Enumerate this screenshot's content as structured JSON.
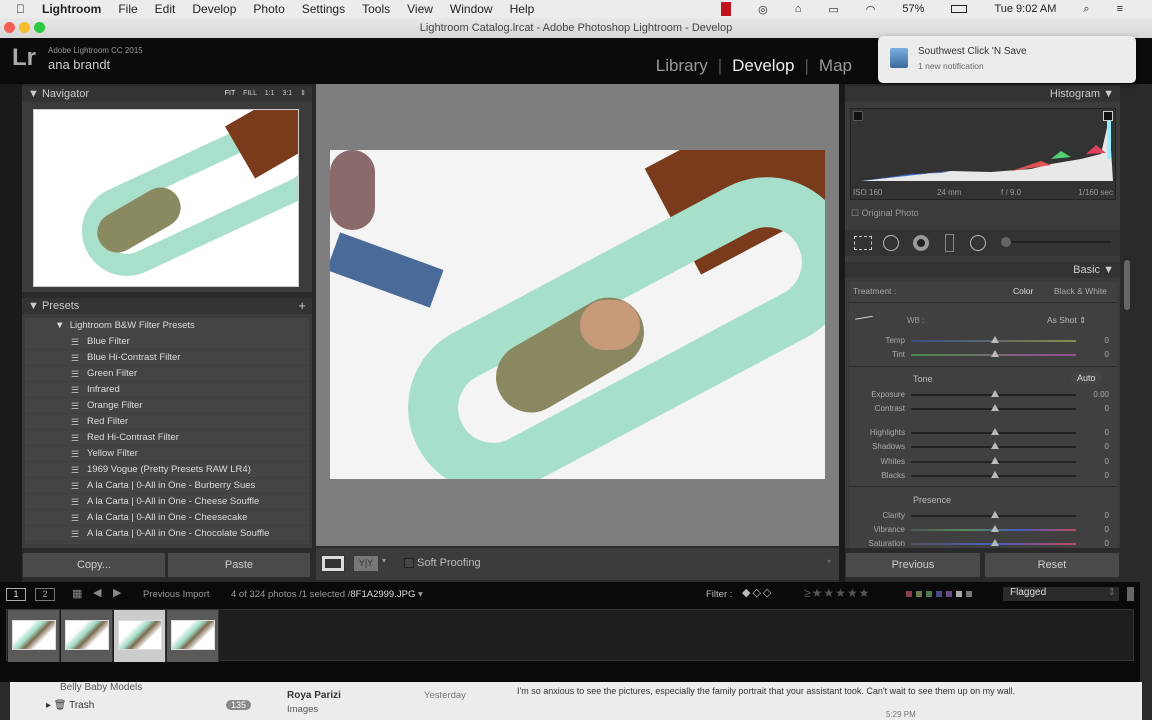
{
  "menubar": {
    "apple": "",
    "items": [
      "Lightroom",
      "File",
      "Edit",
      "Develop",
      "Photo",
      "Settings",
      "Tools",
      "View",
      "Window",
      "Help"
    ],
    "battery": "57%",
    "clock": "Tue 9:02 AM"
  },
  "window": {
    "title": "Lightroom Catalog.lrcat - Adobe Photoshop Lightroom - Develop"
  },
  "header": {
    "logo": "Lr",
    "product": "Adobe Lightroom CC 2015",
    "user": "ana brandt",
    "modules": [
      "Library",
      "Develop",
      "Map"
    ],
    "active_module": "Develop"
  },
  "notification": {
    "title": "Southwest Click 'N Save",
    "body": "1 new notification"
  },
  "navigator": {
    "title": "Navigator",
    "zoom": [
      "FIT",
      "FILL",
      "1:1",
      "3:1"
    ]
  },
  "presets": {
    "title": "Presets",
    "add": "+",
    "folder": "Lightroom B&W Filter Presets",
    "items": [
      "Blue Filter",
      "Blue Hi-Contrast Filter",
      "Green Filter",
      "Infrared",
      "Orange Filter",
      "Red Filter",
      "Red Hi-Contrast Filter",
      "Yellow Filter",
      "1969 Vogue (Pretty Presets RAW LR4)",
      "A la Carta | 0-All in One - Burberry Sues",
      "A la Carta | 0-All in One - Cheese Souffle",
      "A la Carta | 0-All in One - Cheesecake",
      "A la Carta | 0-All in One - Chocolate Souffle"
    ]
  },
  "left_buttons": {
    "copy": "Copy...",
    "paste": "Paste"
  },
  "toolbar": {
    "soft_proofing": "Soft Proofing",
    "view_mode": "Y|Y"
  },
  "histogram": {
    "title": "Histogram",
    "iso": "ISO 160",
    "focal": "24 mm",
    "aperture": "f / 9.0",
    "shutter": "1/160 sec",
    "original_photo": "Original Photo"
  },
  "basic": {
    "title": "Basic",
    "treatment_label": "Treatment :",
    "treatment_color": "Color",
    "treatment_bw": "Black & White",
    "wb_label": "WB :",
    "wb_value": "As Shot",
    "tone": "Tone",
    "auto": "Auto",
    "presence": "Presence",
    "sliders": [
      {
        "label": "Temp",
        "value": "0"
      },
      {
        "label": "Tint",
        "value": "0"
      },
      {
        "label": "Exposure",
        "value": "0.00"
      },
      {
        "label": "Contrast",
        "value": "0"
      },
      {
        "label": "Highlights",
        "value": "0"
      },
      {
        "label": "Shadows",
        "value": "0"
      },
      {
        "label": "Whites",
        "value": "0"
      },
      {
        "label": "Blacks",
        "value": "0"
      },
      {
        "label": "Clarity",
        "value": "0"
      },
      {
        "label": "Vibrance",
        "value": "0"
      },
      {
        "label": "Saturation",
        "value": "0"
      }
    ]
  },
  "right_buttons": {
    "previous": "Previous",
    "reset": "Reset"
  },
  "filmstrip": {
    "screen1": "1",
    "screen2": "2",
    "source": "Previous Import",
    "info": "4 of 324 photos /1 selected /",
    "filename": "8F1A2999.JPG",
    "filter_label": "Filter :",
    "filter_value": "Flagged",
    "label_colors": [
      "#8a3a4a",
      "#6a7a4a",
      "#4a7a4a",
      "#4a4a8a",
      "#6a4a8a",
      "#aaaaaa",
      "#777777"
    ]
  },
  "mail": {
    "folder1": "Belly Baby Models",
    "folder2": "Trash",
    "trash_count": "135",
    "sender": "Roya Parizi",
    "date": "Yesterday",
    "subject": "Images",
    "preview": "I'm so anxious to see the pictures, especially the family portrait that your assistant took.  Can't wait to see them up on my wall.",
    "time": "5:29 PM"
  }
}
